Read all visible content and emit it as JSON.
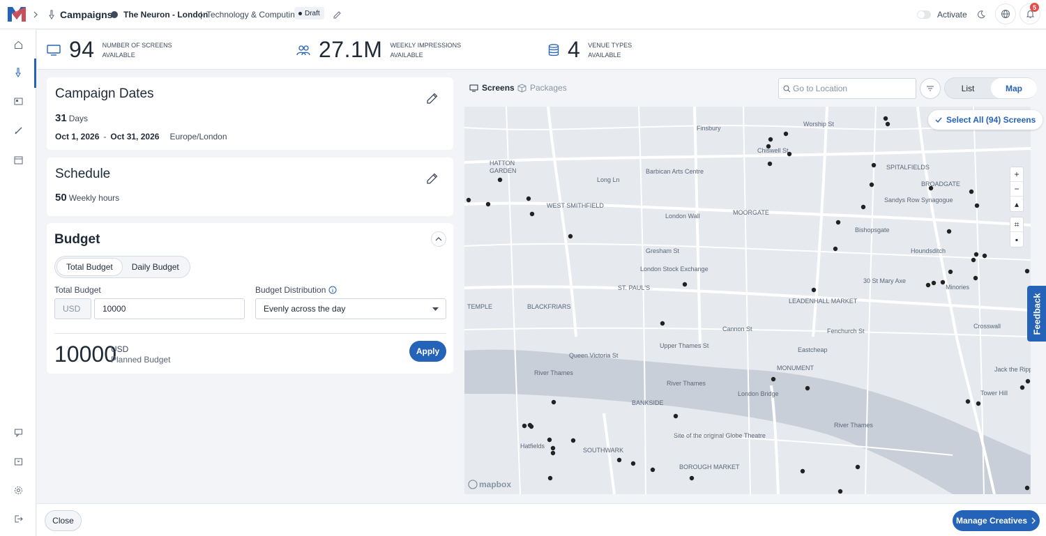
{
  "topbar": {
    "section": "Campaigns",
    "campaign_name": "The Neuron - London",
    "separator": "|",
    "category": "Technology & Computing",
    "status": "Draft",
    "activate_label": "Activate",
    "notification_count": "5"
  },
  "stats": {
    "screens_value": "94",
    "screens_label_1": "Number of screens",
    "screens_label_2": "available",
    "impressions_value": "27.1M",
    "impressions_label_1": "Weekly impressions",
    "impressions_label_2": "available",
    "venue_value": "4",
    "venue_label_1": "Venue types",
    "venue_label_2": "available"
  },
  "dates": {
    "title": "Campaign Dates",
    "days_value": "31",
    "days_label": "Days",
    "start": "Oct 1, 2026",
    "dash": "-",
    "end": "Oct 31, 2026",
    "timezone": "Europe/London"
  },
  "schedule": {
    "title": "Schedule",
    "hours_value": "50",
    "hours_label": "Weekly hours"
  },
  "budget": {
    "title": "Budget",
    "tab_total": "Total Budget",
    "tab_daily": "Daily Budget",
    "total_label": "Total Budget",
    "currency": "USD",
    "amount": "10000",
    "distribution_label": "Budget Distribution",
    "distribution_value": "Evenly across the day",
    "planned_value": "10000",
    "planned_currency": "USD",
    "planned_label": "Planned Budget",
    "apply_label": "Apply"
  },
  "right_panel": {
    "tab_screens": "Screens",
    "tab_packages": "Packages",
    "search_placeholder": "Go to Location",
    "view_list": "List",
    "view_map": "Map",
    "select_all": "Select All (94) Screens"
  },
  "map": {
    "attribution": "mapbox",
    "labels": {
      "finsbury": "Finsbury",
      "worship": "Worship St",
      "hatton": "HATTON",
      "garden": "GARDEN",
      "barbican": "Barbican Arts Centre",
      "spitalfields": "SPITALFIELDS",
      "broadgate": "BROADGATE",
      "long_ln": "Long Ln",
      "west_smithfield": "WEST SMITHFIELD",
      "london_wall": "London Wall",
      "moorgate": "MOORGATE",
      "sandys_row": "Sandys Row Synagogue",
      "gresham": "Gresham St",
      "lse": "London Stock Exchange",
      "st_pauls": "ST. PAUL'S",
      "st_mary_axe": "30 St Mary Axe",
      "leadenhall": "LEADENHALL MARKET",
      "minories": "Minories",
      "temple": "TEMPLE",
      "blackfriars": "BLACKFRIARS",
      "upper_thames": "Upper Thames St",
      "fenchurch": "Fenchurch St",
      "cannon": "Cannon St",
      "eastcheap": "Eastcheap",
      "monument": "MONUMENT",
      "river_thames_1": "River Thames",
      "river_thames_2": "River Thames",
      "river_thames_3": "River Thames",
      "bankside": "BANKSIDE",
      "london_bridge": "London Bridge",
      "globe": "Site of the original Globe Theatre",
      "southwark": "SOUTHWARK",
      "borough_market": "BOROUGH MARKET",
      "jack_ripper": "Jack the Ripper",
      "hatfields": "Hatfields",
      "crosswall": "Crosswall",
      "tower_hill": "Tower Hill",
      "chiswell": "Chiswell St",
      "bishopsgate": "Bishopsgate",
      "houndsditch": "Houndsditch",
      "queen_victoria": "Queen Victoria St"
    }
  },
  "footer": {
    "close_label": "Close",
    "manage_label": "Manage Creatives"
  },
  "feedback_label": "Feedback",
  "colors": {
    "accent": "#2563b8",
    "badge": "#e54b4b",
    "map_bg": "#e6e9ee",
    "water": "#c9cfd8"
  }
}
